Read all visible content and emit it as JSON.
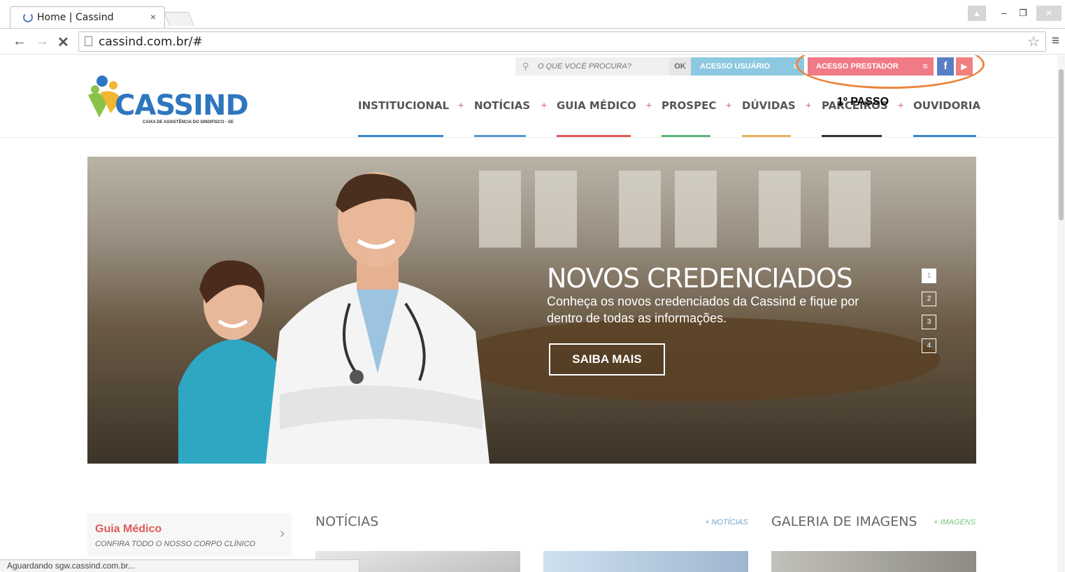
{
  "browser": {
    "tab_title": "Home | Cassind",
    "tab_close": "×",
    "url": "cassind.com.br/#",
    "status_text": "Aguardando sgw.cassind.com.br..."
  },
  "topbar": {
    "search_placeholder": "O QUE VOCÊ PROCURA?",
    "ok_label": "OK",
    "acesso_usuario": "ACESSO USUÁRIO",
    "acesso_prestador": "ACESSO PRESTADOR",
    "facebook": "f",
    "youtube": "▶",
    "passo_annotation": "1º PASSO"
  },
  "logo": {
    "name": "CASSIND",
    "subtitle": "CAIXA DE ASSISTÊNCIA DO SINDIFISCO - SE"
  },
  "nav": {
    "items": [
      {
        "label": "INSTITUCIONAL",
        "color": "#3a87c8"
      },
      {
        "label": "NOTÍCIAS",
        "color": "#5a9bd5"
      },
      {
        "label": "GUIA MÉDICO",
        "color": "#e05a5a"
      },
      {
        "label": "PROSPEC",
        "color": "#5ab878"
      },
      {
        "label": "DÚVIDAS",
        "color": "#e8b35a"
      },
      {
        "label": "PARCEIROS",
        "color": "#333333"
      },
      {
        "label": "OUVIDORIA",
        "color": "#3a87c8"
      }
    ]
  },
  "hero": {
    "title": "NOVOS CREDENCIADOS",
    "subtitle": "Conheça os novos credenciados da Cassind e fique por dentro de todas as informações.",
    "button": "SAIBA MAIS",
    "slides": [
      "1",
      "2",
      "3",
      "4"
    ],
    "active_slide": "1"
  },
  "guia": {
    "title": "Guia Médico",
    "subtitle": "CONFIRA TODO O NOSSO CORPO CLÍNICO"
  },
  "sections": {
    "noticias": "NOTÍCIAS",
    "noticias_more": "+ NOTÍCIAS",
    "galeria": "GALERIA DE IMAGENS",
    "galeria_more": "+ IMAGENS"
  }
}
